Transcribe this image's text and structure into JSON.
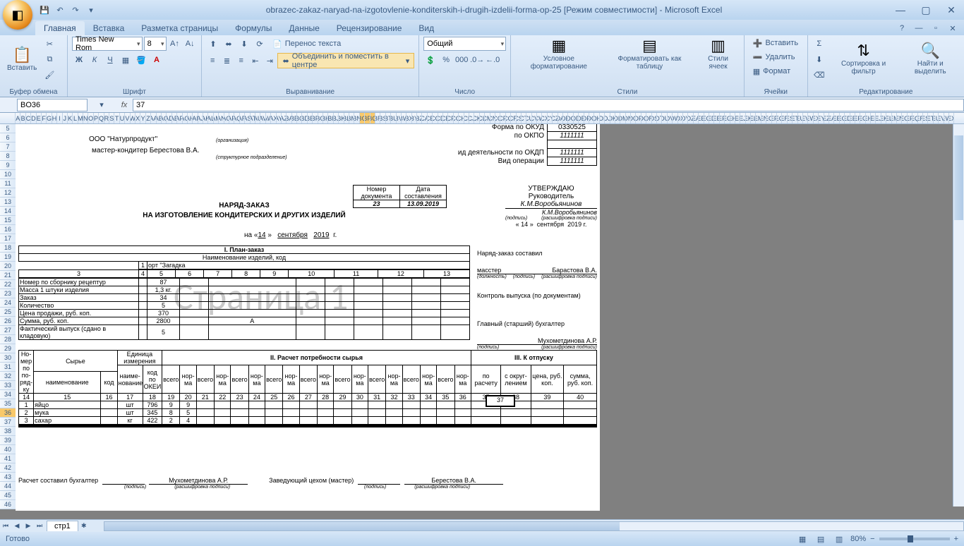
{
  "title": "obrazec-zakaz-naryad-na-izgotovlenie-konditerskih-i-drugih-izdelii-forma-op-25 [Режим совместимости] - Microsoft Excel",
  "tabs": [
    "Главная",
    "Вставка",
    "Разметка страницы",
    "Формулы",
    "Данные",
    "Рецензирование",
    "Вид"
  ],
  "active_tab": 0,
  "groups": {
    "clipboard": "Буфер обмена",
    "font": "Шрифт",
    "align": "Выравнивание",
    "number": "Число",
    "styles": "Стили",
    "cells": "Ячейки",
    "editing": "Редактирование"
  },
  "ribbon": {
    "paste": "Вставить",
    "font_name": "Times New Rom",
    "font_size": "8",
    "wrap": "Перенос текста",
    "merge": "Объединить и поместить в центре",
    "num_format": "Общий",
    "cond": "Условное форматирование",
    "table": "Форматировать как таблицу",
    "cell_styles": "Стили ячеек",
    "insert": "Вставить",
    "delete": "Удалить",
    "format": "Формат",
    "sort": "Сортировка и фильтр",
    "find": "Найти и выделить"
  },
  "name_box": "BO36",
  "formula": "37",
  "sheet_tab": "стр1",
  "status_ready": "Готово",
  "zoom": "80%",
  "form": {
    "org": "ООО \"Натурпродукт\"",
    "org_sub": "(организация)",
    "master": "мастер-кондитер Берестова В.А.",
    "master_sub": "(структурное подразделение)",
    "okud_lbl": "Форма по ОКУД",
    "okud": "0330525",
    "okpo_lbl": "по ОКПО",
    "okpo": "1111111",
    "okdp_lbl": "ид деятельности по ОКДП",
    "okdp": "1111111",
    "oper_lbl": "Вид операции",
    "oper": "1111111",
    "doc_num_lbl": "Номер документа",
    "doc_date_lbl": "Дата составления",
    "doc_num": "23",
    "doc_date": "13.09.2019",
    "title1": "НАРЯД-ЗАКАЗ",
    "title2": "НА ИЗГОТОВЛЕНИЕ КОНДИТЕРСКИХ И ДРУГИХ ИЗДЕЛИЙ",
    "date_line_prefix": "на «",
    "date_d": "14",
    "date_m": "сентября",
    "date_y": "2019",
    "date_suffix": "г.",
    "approve": "УТВЕРЖДАЮ",
    "ruk": "Руководитель",
    "ruk_name": "К.М.Воробьянинов",
    "ruk_name2": "К.М.Воробьянинов",
    "podpis": "(подпись)",
    "rasshifr": "(расшифровка подписи)",
    "plan_hdr": "I. План-заказ",
    "naim_hdr": "Наименование изделий, код",
    "naryad_sostavil": "Наряд-заказ составил",
    "master_pos": "масстер",
    "master_name": "Барастова В.А.",
    "dolzhnost": "(должность)",
    "kontrol": "Контроль выпуска (по документам)",
    "glav_buh": "Главный (старший) бухгалтер",
    "glav_buh_name": "Мухометдинова А.Р.",
    "row_labels": [
      "Номер по сборнику рецептур",
      "Масса 1 штуки изделия",
      "Заказ",
      "Количество",
      "Цена продажи, руб. коп.",
      "Сумма, руб. коп.",
      "Фактический выпуск (сдано в кладовую)"
    ],
    "plan_vals": [
      "87",
      "1,3 кг.",
      "34",
      "5",
      "370",
      "2800",
      "5"
    ],
    "plan_extra": "A",
    "zagadka": "орт \"Загадка",
    "cols_hdr": [
      "3",
      "4",
      "5",
      "6",
      "7",
      "8",
      "9",
      "10",
      "11",
      "12",
      "13"
    ],
    "raschet_hdr": "II. Расчет потребности сырья",
    "otpusk_hdr": "III. К отпуску",
    "nomer_po": "Но-мер по по-ряд-ку",
    "syre": "Сырье",
    "ed_izm": "Единица измерения",
    "naimen": "наименование",
    "kod": "код",
    "naimen2": "наиме-нование",
    "kod_okei": "код по ОКЕИ",
    "vsego": "всего",
    "norma": "нор-ма",
    "po_raschetu": "по расчету",
    "s_okrug": "с округ-лением",
    "cena": "цена, руб. коп.",
    "summa": "сумма, руб. коп.",
    "row_nums": [
      "14",
      "15",
      "16",
      "17",
      "18",
      "19",
      "20",
      "21",
      "22",
      "23",
      "24",
      "25",
      "26",
      "27",
      "28",
      "29",
      "30",
      "31",
      "32",
      "33",
      "34",
      "35",
      "36",
      "37",
      "38",
      "39",
      "40"
    ],
    "ing": [
      {
        "n": "1",
        "name": "яйцо",
        "ed": "шт",
        "kod": "796",
        "v1": "9",
        "v2": "9"
      },
      {
        "n": "2",
        "name": "мука",
        "ed": "шт",
        "kod": "345",
        "v1": "8",
        "v2": "5"
      },
      {
        "n": "3",
        "name": "сахар",
        "ed": "кг",
        "kod": "422",
        "v1": "2",
        "v2": "4"
      }
    ],
    "footer_buh": "Расчет составил бухгалтер",
    "footer_buh_name": "Мухометдинова А.Р.",
    "footer_ceh": "Заведующий цехом (мастер)",
    "footer_ceh_name": "Берестова В.А.",
    "active_cell_val": "37",
    "watermark": "Страница 1"
  }
}
